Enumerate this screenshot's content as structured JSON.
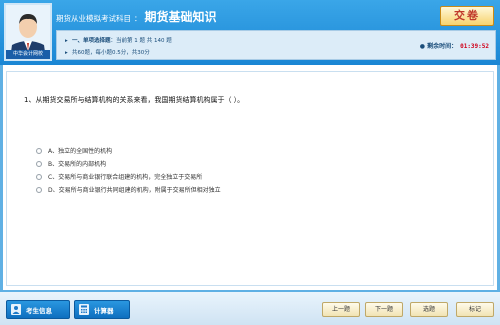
{
  "header": {
    "title_prefix": "期货从业模拟考试科目",
    "title_separator": "：",
    "title_main": "期货基础知识",
    "submit_label": "交卷",
    "avatar_caption": "中华会计网校"
  },
  "info": {
    "section_label": "一、单项选择题",
    "section_progress": "：当前第 1 题 共 140 题",
    "summary": "共60题，每小题0.5分，共30分",
    "timer_label": "剩余时间：",
    "timer_value": "01:39:52"
  },
  "question": {
    "text": "1、从期货交易所与结算机构的关系来看，我国期货结算机构属于（    ）。",
    "options": [
      "A、独立的全国性的机构",
      "B、交易所的内部机构",
      "C、交易所与商业银行联合组建的机构，完全独立于交易所",
      "D、交易所与商业银行共同组建的机构，附属于交易所但相对独立"
    ]
  },
  "footer": {
    "candidate_info": "考生信息",
    "calculator": "计算器",
    "prev": "上一题",
    "next": "下一题",
    "select": "选题",
    "mark": "标记"
  },
  "colors": {
    "header_blue": "#1a86d4",
    "timer_red": "#d0021b",
    "submit_text": "#c0392b"
  }
}
